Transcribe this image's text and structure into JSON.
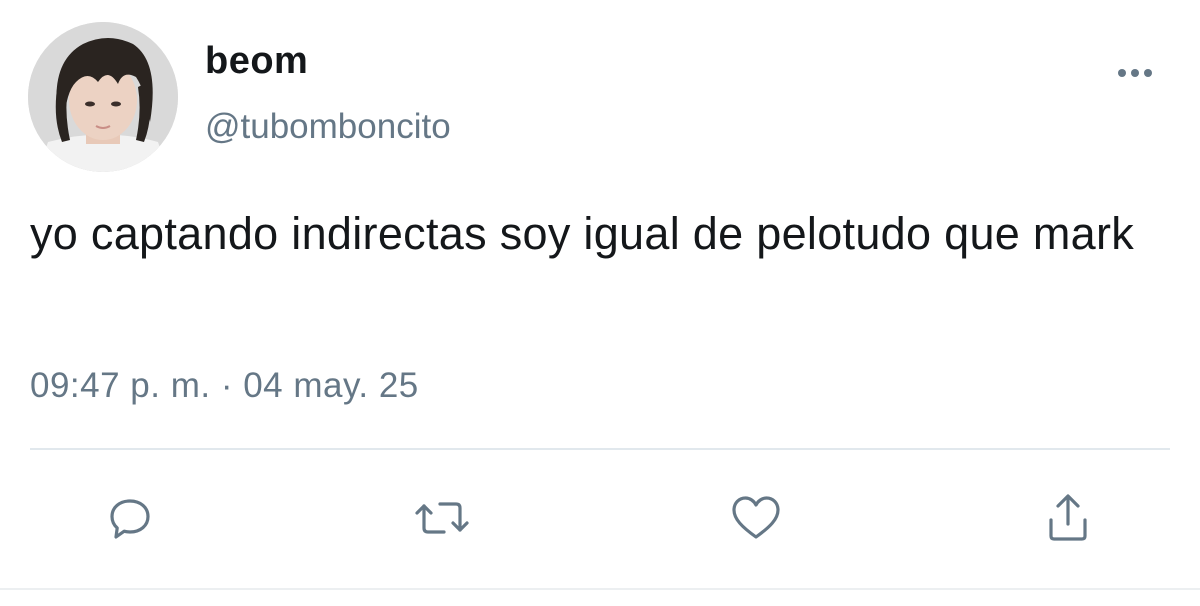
{
  "author": {
    "display_name": "beom",
    "handle": "@tubomboncito",
    "avatar_icon": "profile-photo"
  },
  "tweet": {
    "text": "yo captando indirectas soy igual de pelotudo que mark",
    "timestamp": "09:47 p. m. · 04 may. 25"
  },
  "actions": {
    "reply_icon": "speech-bubble-icon",
    "retweet_icon": "retweet-arrows-icon",
    "like_icon": "heart-icon",
    "share_icon": "share-upload-icon"
  },
  "colors": {
    "text_primary": "#14171a",
    "text_secondary": "#657786",
    "icon": "#657786",
    "divider": "#e1e8ed"
  }
}
